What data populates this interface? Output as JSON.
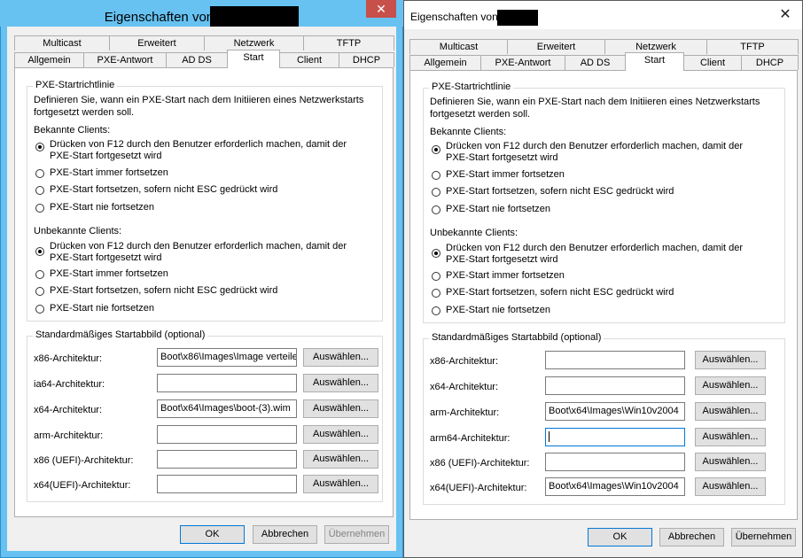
{
  "left": {
    "title": "Eigenschaften von",
    "close_glyph": "✕",
    "tabs_row1": [
      "Multicast",
      "Erweitert",
      "Netzwerk",
      "TFTP"
    ],
    "tabs_row2": [
      "Allgemein",
      "PXE-Antwort",
      "AD DS",
      "Start",
      "Client",
      "DHCP"
    ],
    "active_tab": "Start",
    "pxe_group": "PXE-Startrichtlinie",
    "pxe_desc_1": "Definieren Sie, wann ein PXE-Start nach dem Initiieren eines Netzwerkstarts",
    "pxe_desc_2": "fortgesetzt werden soll.",
    "known_label": "Bekannte Clients:",
    "unknown_label": "Unbekannte Clients:",
    "opt_f12_1": "Drücken von F12 durch den Benutzer erforderlich machen, damit der",
    "opt_f12_2": "PXE-Start fortgesetzt wird",
    "opt_always": "PXE-Start immer fortsetzen",
    "opt_esc": "PXE-Start fortsetzen, sofern nicht ESC gedrückt wird",
    "opt_never": "PXE-Start nie fortsetzen",
    "image_group": "Standardmäßiges Startabbild (optional)",
    "arch_rows": [
      {
        "label": "x86-Architektur:",
        "value": "Boot\\x86\\Images\\Image verteile"
      },
      {
        "label": "ia64-Architektur:",
        "value": ""
      },
      {
        "label": "x64-Architektur:",
        "value": "Boot\\x64\\Images\\boot-(3).wim"
      },
      {
        "label": "arm-Architektur:",
        "value": ""
      },
      {
        "label": "x86 (UEFI)-Architektur:",
        "value": ""
      },
      {
        "label": "x64(UEFI)-Architektur:",
        "value": ""
      }
    ],
    "select_label": "Auswählen...",
    "ok": "OK",
    "cancel": "Abbrechen",
    "apply": "Übernehmen"
  },
  "right": {
    "title": "Eigenschaften von",
    "close_glyph": "✕",
    "tabs_row1": [
      "Multicast",
      "Erweitert",
      "Netzwerk",
      "TFTP"
    ],
    "tabs_row2": [
      "Allgemein",
      "PXE-Antwort",
      "AD DS",
      "Start",
      "Client",
      "DHCP"
    ],
    "active_tab": "Start",
    "pxe_group": "PXE-Startrichtlinie",
    "pxe_desc_1": "Definieren Sie, wann ein PXE-Start nach dem Initiieren eines Netzwerkstarts",
    "pxe_desc_2": "fortgesetzt werden soll.",
    "known_label": "Bekannte Clients:",
    "unknown_label": "Unbekannte Clients:",
    "opt_f12_1": "Drücken von F12 durch den Benutzer erforderlich machen, damit der",
    "opt_f12_2": "PXE-Start fortgesetzt wird",
    "opt_always": "PXE-Start immer fortsetzen",
    "opt_esc": "PXE-Start fortsetzen, sofern nicht ESC gedrückt wird",
    "opt_never": "PXE-Start nie fortsetzen",
    "image_group": "Standardmäßiges Startabbild (optional)",
    "arch_rows": [
      {
        "label": "x86-Architektur:",
        "value": ""
      },
      {
        "label": "x64-Architektur:",
        "value": ""
      },
      {
        "label": "arm-Architektur:",
        "value": "Boot\\x64\\Images\\Win10v2004"
      },
      {
        "label": "arm64-Architektur:",
        "value": ""
      },
      {
        "label": "x86 (UEFI)-Architektur:",
        "value": ""
      },
      {
        "label": "x64(UEFI)-Architektur:",
        "value": "Boot\\x64\\Images\\Win10v2004"
      }
    ],
    "select_label": "Auswählen...",
    "ok": "OK",
    "cancel": "Abbrechen",
    "apply": "Übernehmen"
  }
}
